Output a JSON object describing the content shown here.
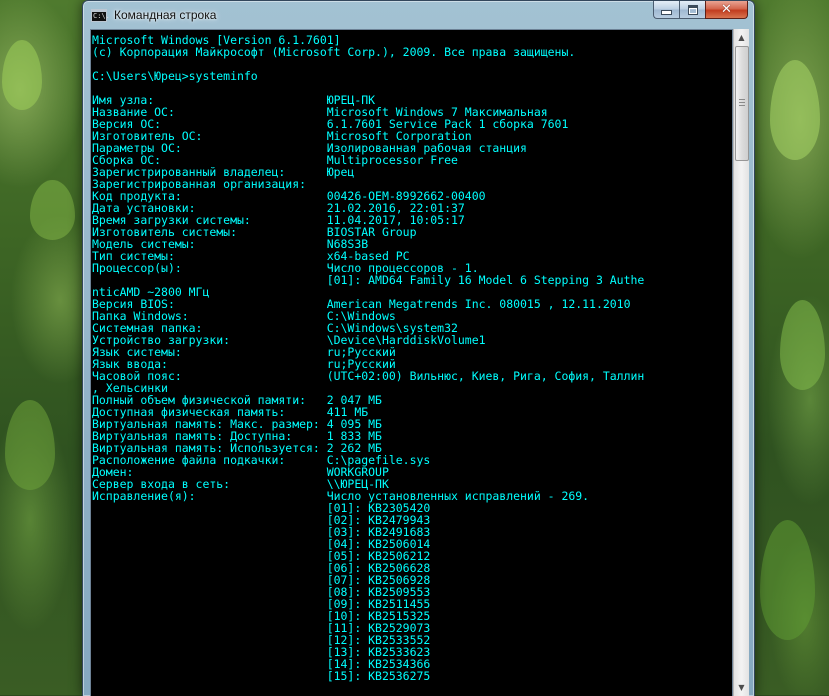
{
  "window": {
    "title": "Командная строка",
    "icon_text": "C:\\."
  },
  "icons": {
    "minimize": "minimize-icon",
    "maximize": "maximize-icon",
    "close": "close-icon",
    "close_glyph": "✕",
    "scroll_up_glyph": "▲",
    "scroll_down_glyph": "▼"
  },
  "console": {
    "lines": [
      "Microsoft Windows [Version 6.1.7601]",
      "(c) Корпорация Майкрософт (Microsoft Corp.), 2009. Все права защищены.",
      "",
      "C:\\Users\\Юрец>systeminfo",
      "",
      "Имя узла:                         ЮРЕЦ-ПК",
      "Название ОС:                      Microsoft Windows 7 Максимальная",
      "Версия ОС:                        6.1.7601 Service Pack 1 сборка 7601",
      "Изготовитель ОС:                  Microsoft Corporation",
      "Параметры ОС:                     Изолированная рабочая станция",
      "Сборка ОС:                        Multiprocessor Free",
      "Зарегистрированный владелец:      Юрец",
      "Зарегистрированная организация:",
      "Код продукта:                     00426-OEM-8992662-00400",
      "Дата установки:                   21.02.2016, 22:01:37",
      "Время загрузки системы:           11.04.2017, 10:05:17",
      "Изготовитель системы:             BIOSTAR Group",
      "Модель системы:                   N68S3B",
      "Тип системы:                      x64-based PC",
      "Процессор(ы):                     Число процессоров - 1.",
      "                                  [01]: AMD64 Family 16 Model 6 Stepping 3 Authe",
      "nticAMD ~2800 МГц",
      "Версия BIOS:                      American Megatrends Inc. 080015 , 12.11.2010",
      "Папка Windows:                    C:\\Windows",
      "Системная папка:                  C:\\Windows\\system32",
      "Устройство загрузки:              \\Device\\HarddiskVolume1",
      "Язык системы:                     ru;Русский",
      "Язык ввода:                       ru;Русский",
      "Часовой пояс:                     (UTC+02:00) Вильнюс, Киев, Рига, София, Таллин",
      ", Хельсинки",
      "Полный объем физической памяти:   2 047 МБ",
      "Доступная физическая память:      411 МБ",
      "Виртуальная память: Макс. размер: 4 095 МБ",
      "Виртуальная память: Доступна:     1 833 МБ",
      "Виртуальная память: Используется: 2 262 МБ",
      "Расположение файла подкачки:      C:\\pagefile.sys",
      "Домен:                            WORKGROUP",
      "Сервер входа в сеть:              \\\\ЮРЕЦ-ПК",
      "Исправление(я):                   Число установленных исправлений - 269.",
      "                                  [01]: KB2305420",
      "                                  [02]: KB2479943",
      "                                  [03]: KB2491683",
      "                                  [04]: KB2506014",
      "                                  [05]: KB2506212",
      "                                  [06]: KB2506628",
      "                                  [07]: KB2506928",
      "                                  [08]: KB2509553",
      "                                  [09]: KB2511455",
      "                                  [10]: KB2515325",
      "                                  [11]: KB2529073",
      "                                  [12]: KB2533552",
      "                                  [13]: KB2533623",
      "                                  [14]: KB2534366",
      "                                  [15]: KB2536275"
    ]
  },
  "colors": {
    "console_text": "#00ffff",
    "console_background": "#000000"
  }
}
